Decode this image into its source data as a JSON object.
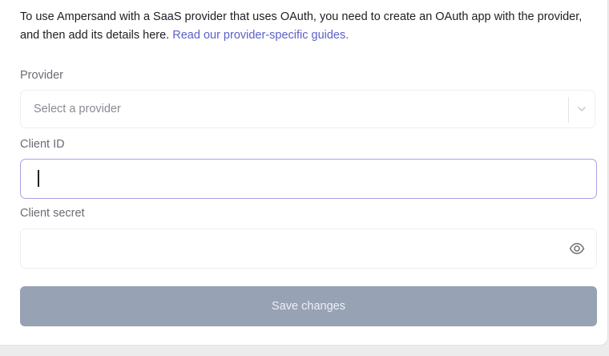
{
  "intro": {
    "text": "To use Ampersand with a SaaS provider that uses OAuth, you need to create an OAuth app with the provider, and then add its details here. ",
    "link_text": "Read our provider-specific guides."
  },
  "provider": {
    "label": "Provider",
    "placeholder": "Select a provider",
    "icon": "chevron-down-icon"
  },
  "client_id": {
    "label": "Client ID",
    "value": ""
  },
  "client_secret": {
    "label": "Client secret",
    "value": "",
    "icon": "eye-icon"
  },
  "save_button": {
    "label": "Save changes",
    "color": "#97a2b4"
  },
  "colors": {
    "link": "#5b5fc7",
    "focus_border": "#a6a3e8"
  }
}
